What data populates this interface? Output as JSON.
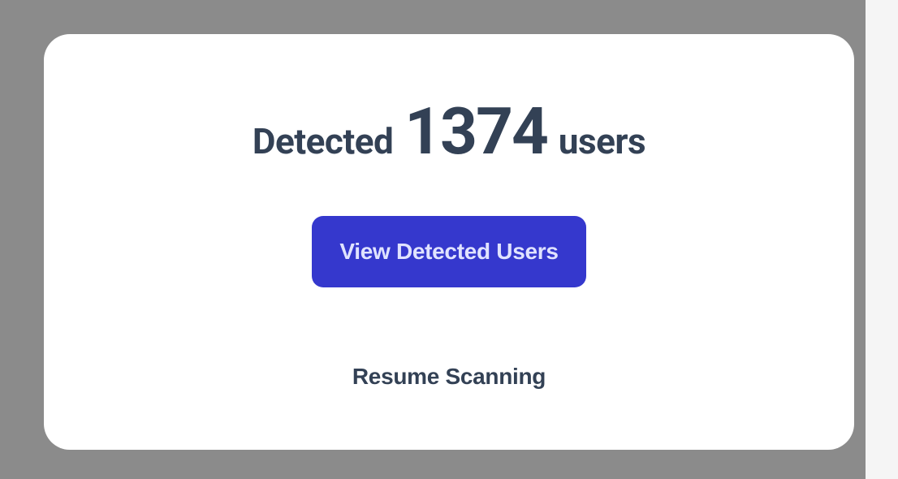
{
  "modal": {
    "headline": {
      "prefix": "Detected",
      "count": "1374",
      "suffix": "users"
    },
    "primary_button_label": "View Detected Users",
    "secondary_button_label": "Resume Scanning"
  },
  "colors": {
    "card_bg": "#ffffff",
    "backdrop": "#8b8b8b",
    "text_primary": "#334155",
    "button_bg": "#3538cd",
    "button_text": "#e0e3ff"
  }
}
